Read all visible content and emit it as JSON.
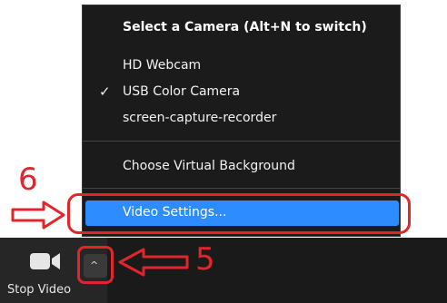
{
  "menu": {
    "header": "Select a Camera (Alt+N to switch)",
    "items": [
      {
        "label": "HD Webcam",
        "checked": false
      },
      {
        "label": "USB Color Camera",
        "checked": true
      },
      {
        "label": "screen-capture-recorder",
        "checked": false
      }
    ],
    "check_glyph": "✓",
    "virtual_background": "Choose Virtual Background",
    "video_settings": "Video Settings..."
  },
  "toolbar": {
    "stop_video_label": "Stop Video",
    "caret_glyph": "^"
  },
  "annotations": {
    "step_6": "6",
    "step_5": "5"
  },
  "colors": {
    "highlight": "#2d8cff",
    "annotation": "#e0262b",
    "menu_bg": "#1b1b1b"
  }
}
